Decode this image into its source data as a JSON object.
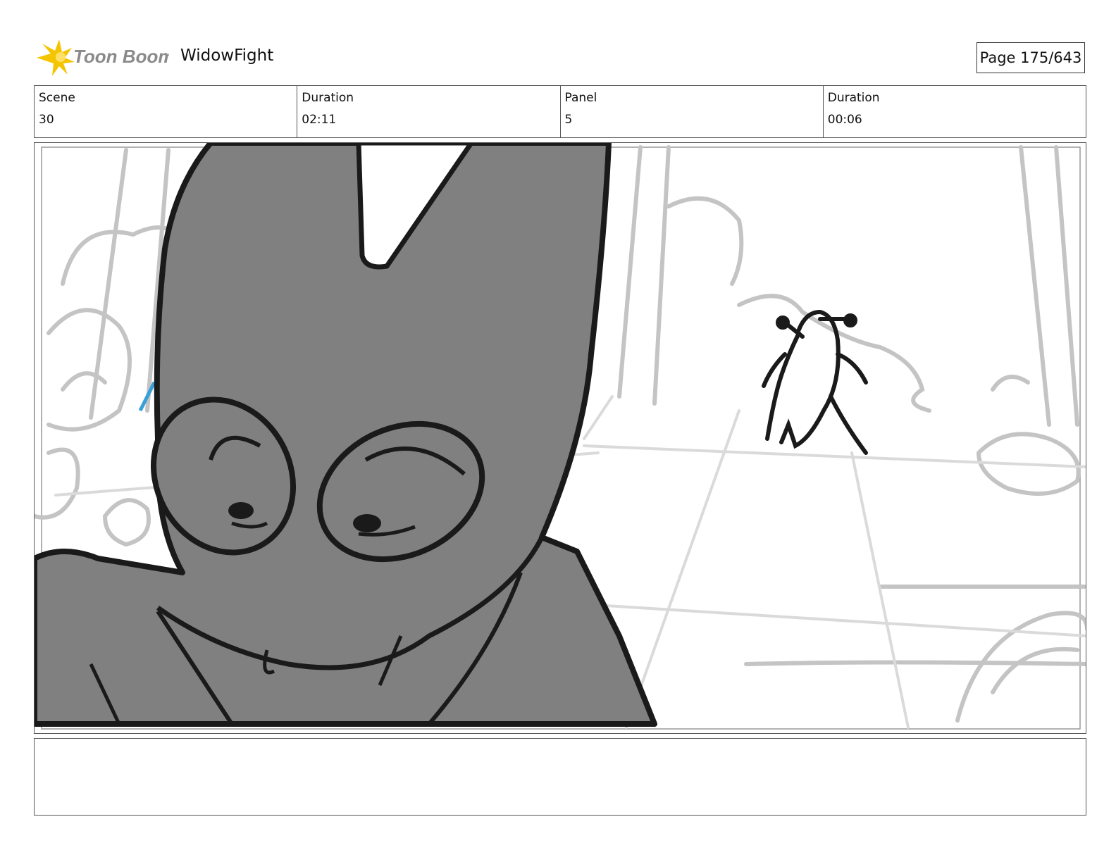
{
  "header": {
    "brand": "Toon Boom",
    "project_title": "WidowFight",
    "page_label": "Page 175/643"
  },
  "info": {
    "scene_label": "Scene",
    "scene_value": "30",
    "scene_duration_label": "Duration",
    "scene_duration_value": "02:11",
    "panel_label": "Panel",
    "panel_value": "5",
    "panel_duration_label": "Duration",
    "panel_duration_value": "00:06"
  },
  "notes": {
    "text": ""
  },
  "colors": {
    "logo_star": "#f5c400",
    "logo_text": "#8a8a8a",
    "sketch_fill": "#808080",
    "sketch_line": "#1a1a1a",
    "background_sketch": "#c4c4c4",
    "accent_line": "#3a9fd8"
  }
}
